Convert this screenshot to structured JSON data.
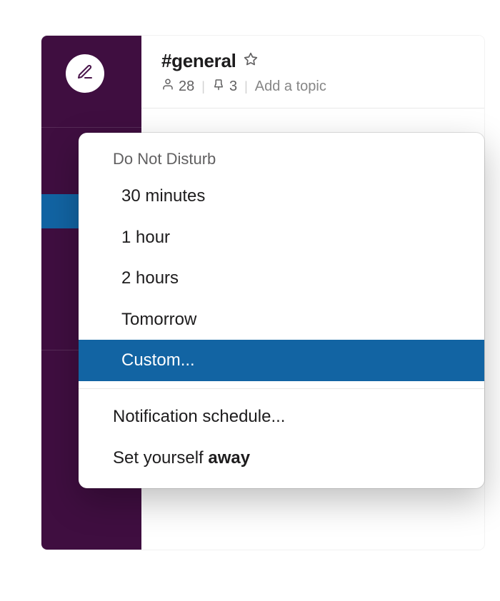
{
  "channel": {
    "name": "#general",
    "member_count": "28",
    "pinned_count": "3",
    "topic_placeholder": "Add a topic"
  },
  "menu": {
    "section_header": "Do Not Disturb",
    "options": {
      "opt_30min": "30 minutes",
      "opt_1hour": "1 hour",
      "opt_2hours": "2 hours",
      "opt_tomorrow": "Tomorrow",
      "opt_custom": "Custom..."
    },
    "notification_schedule": "Notification schedule...",
    "set_away_prefix": "Set yourself ",
    "set_away_bold": "away"
  }
}
